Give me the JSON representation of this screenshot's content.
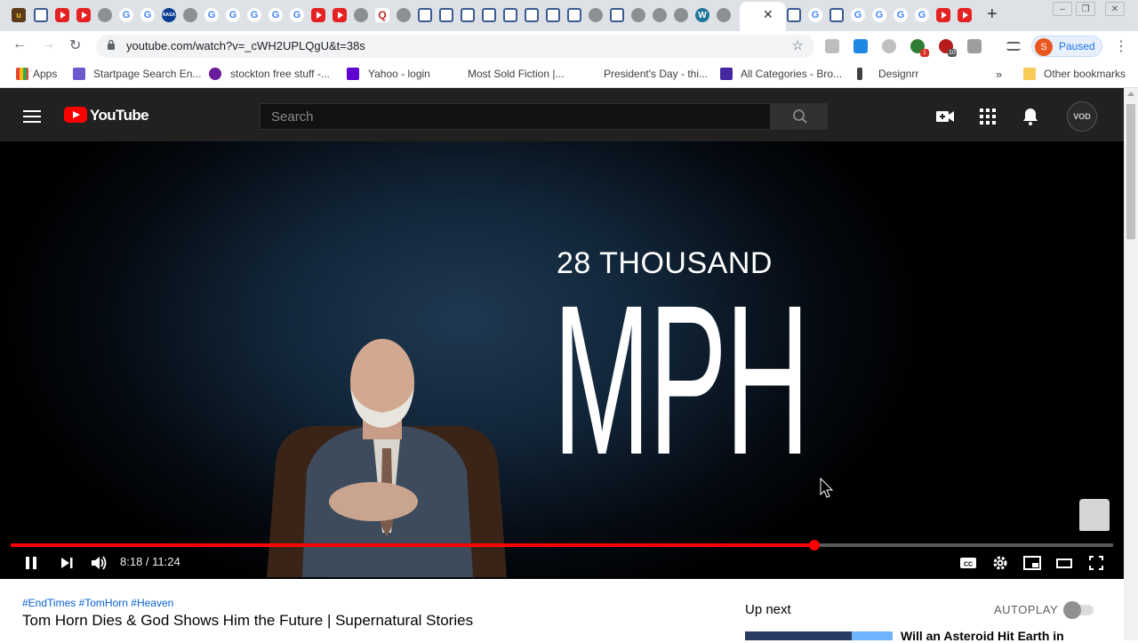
{
  "browser": {
    "url": "youtube.com/watch?v=_cWH2UPLQgU&t=38s",
    "profile_initial": "S",
    "profile_status": "Paused",
    "new_tab_label": "+",
    "tab_close_label": "✕",
    "ext_badge_1": "1",
    "ext_badge_2": "10"
  },
  "bookmarks": [
    "Apps",
    "Startpage Search En...",
    "stockton free stuff -...",
    "Yahoo - login",
    "Most Sold Fiction |...",
    "President's Day - thi...",
    "All Categories - Bro...",
    "Designrr"
  ],
  "bookmarks_overflow": "»",
  "bookmarks_other": "Other bookmarks",
  "youtube": {
    "logo_text": "YouTube",
    "search_placeholder": "Search",
    "avatar_text": "VOD"
  },
  "video": {
    "overlay_small": "28 THOUSAND",
    "overlay_big": "MPH",
    "current_time": "8:18",
    "duration": "11:24",
    "time_display": "8:18 / 11:24",
    "progress_fraction": 0.7288
  },
  "info": {
    "tags": "#EndTimes #TomHorn #Heaven",
    "title": "Tom Horn Dies & God Shows Him the Future | Supernatural Stories"
  },
  "sidebar": {
    "up_next": "Up next",
    "autoplay": "AUTOPLAY",
    "next_title": "Will an Asteroid Hit Earth in"
  },
  "colors": {
    "yt_red": "#ff0000",
    "yt_header": "#212121",
    "link_blue": "#065fd4"
  }
}
